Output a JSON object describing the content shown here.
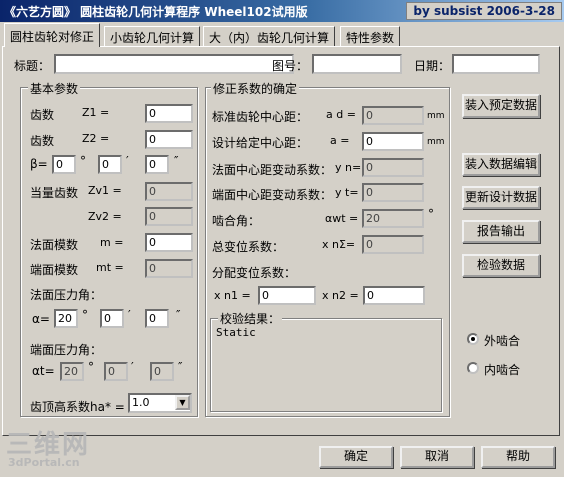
{
  "window": {
    "title": "《六艺方圆》 圆柱齿轮几何计算程序 Wheel102试用版",
    "author": "by subsist 2006-3-28"
  },
  "tabs": [
    "圆柱齿轮对修正",
    "小齿轮几何计算",
    "大（内）齿轮几何计算",
    "特性参数"
  ],
  "header": {
    "title_label": "标题：",
    "title_value": "",
    "drawing_label": "图号：",
    "drawing_value": "",
    "date_label": "日期：",
    "date_value": ""
  },
  "basic": {
    "legend": "基本参数",
    "z1_label": "齿数",
    "z1_sym": "Z1 =",
    "z1_value": "0",
    "z2_label": "齿数",
    "z2_sym": "Z2 =",
    "z2_value": "0",
    "beta_sym": "β=",
    "beta_deg": "0",
    "beta_min": "0",
    "beta_sec": "0",
    "deg": "°",
    "min": "′",
    "sec": "″",
    "zv_label": "当量齿数",
    "zv1_sym": "Zv1 =",
    "zv1_value": "0",
    "zv2_sym": "Zv2 =",
    "zv2_value": "0",
    "mn_label": "法面模数",
    "mn_sym": "m =",
    "mn_value": "0",
    "mt_label": "端面模数",
    "mt_sym": "mt =",
    "mt_value": "0",
    "alpha_label": "法面压力角：",
    "alpha_sym": "α=",
    "alpha_deg": "20",
    "alpha_min": "0",
    "alpha_sec": "0",
    "alphat_label": "端面压力角：",
    "alphat_sym": "αt=",
    "alphat_deg": "20",
    "alphat_min": "0",
    "alphat_sec": "0",
    "ha_label": "齿顶高系数ha* =",
    "ha_value": "1.0"
  },
  "corr": {
    "legend": "修正系数的确定",
    "ad_label": "标准齿轮中心距：",
    "ad_sym": "a d =",
    "ad_value": "0",
    "ad_unit": "mm",
    "a_label": "设计给定中心距：",
    "a_sym": "a =",
    "a_value": "0",
    "a_unit": "mm",
    "yn_label": "法面中心距变动系数：",
    "yn_sym": "y n=",
    "yn_value": "0",
    "yt_label": "端面中心距变动系数：",
    "yt_sym": "y t=",
    "yt_value": "0",
    "awt_label": "啮合角：",
    "awt_sym": "αwt =",
    "awt_value": "20",
    "awt_deg": "°",
    "xsum_label": "总变位系数：",
    "xsum_sym": "x nΣ=",
    "xsum_value": "0",
    "xdist_label": "分配变位系数：",
    "xn1_sym": "x n1 =",
    "xn1_value": "0",
    "xn2_sym": "x n2 =",
    "xn2_value": "0",
    "check_legend": "校验结果：",
    "check_text": "Static"
  },
  "actions": {
    "load_preset": "装入预定数据",
    "load_edit": "装入数据编辑",
    "update": "更新设计数据",
    "report": "报告输出",
    "verify": "检验数据"
  },
  "gear_type": {
    "external": "外啮合",
    "internal": "内啮合",
    "selected": "external"
  },
  "footer": {
    "ok": "确定",
    "cancel": "取消",
    "help": "帮助"
  },
  "watermark": {
    "logo": "三维网",
    "site": "3dPortal.cn"
  }
}
